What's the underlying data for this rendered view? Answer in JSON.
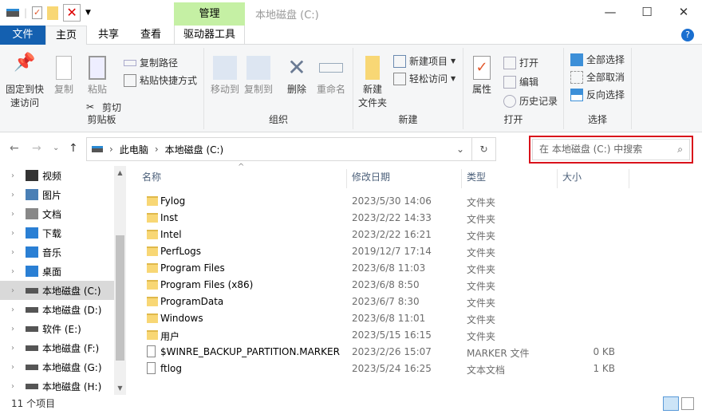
{
  "window": {
    "title": "本地磁盘 (C:)",
    "context_tab": "管理",
    "minimize": "—",
    "maximize": "☐",
    "close": "✕"
  },
  "tabs": {
    "file": "文件",
    "home": "主页",
    "share": "共享",
    "view": "查看",
    "drive_tools": "驱动器工具"
  },
  "ribbon": {
    "clipboard": {
      "label": "剪贴板",
      "pin": "固定到快速访问",
      "copy": "复制",
      "paste": "粘贴",
      "copy_path": "复制路径",
      "paste_shortcut": "粘贴快捷方式",
      "cut": "剪切"
    },
    "organize": {
      "label": "组织",
      "move_to": "移动到",
      "copy_to": "复制到",
      "delete": "删除",
      "rename": "重命名"
    },
    "new": {
      "label": "新建",
      "new_folder": "新建\n文件夹",
      "new_item": "新建项目",
      "easy_access": "轻松访问"
    },
    "open": {
      "label": "打开",
      "properties": "属性",
      "open": "打开",
      "edit": "编辑",
      "history": "历史记录"
    },
    "select": {
      "label": "选择",
      "select_all": "全部选择",
      "select_none": "全部取消",
      "invert": "反向选择"
    }
  },
  "address": {
    "crumbs": [
      "此电脑",
      "本地磁盘 (C:)"
    ],
    "search_placeholder": "在 本地磁盘 (C:) 中搜索"
  },
  "sidebar": [
    {
      "label": "视频",
      "icon": "video-icon"
    },
    {
      "label": "图片",
      "icon": "pictures-icon"
    },
    {
      "label": "文档",
      "icon": "documents-icon"
    },
    {
      "label": "下载",
      "icon": "download-icon"
    },
    {
      "label": "音乐",
      "icon": "music-icon"
    },
    {
      "label": "桌面",
      "icon": "desktop-icon"
    },
    {
      "label": "本地磁盘 (C:)",
      "icon": "drive-icon",
      "selected": true
    },
    {
      "label": "本地磁盘 (D:)",
      "icon": "drive-icon"
    },
    {
      "label": "软件 (E:)",
      "icon": "drive-icon"
    },
    {
      "label": "本地磁盘 (F:)",
      "icon": "drive-icon"
    },
    {
      "label": "本地磁盘 (G:)",
      "icon": "drive-icon"
    },
    {
      "label": "本地磁盘 (H:)",
      "icon": "drive-icon"
    }
  ],
  "columns": {
    "name": "名称",
    "date": "修改日期",
    "type": "类型",
    "size": "大小"
  },
  "files": [
    {
      "name": "Fylog",
      "date": "2023/5/30 14:06",
      "type": "文件夹",
      "size": "",
      "kind": "folder"
    },
    {
      "name": "Inst",
      "date": "2023/2/22 14:33",
      "type": "文件夹",
      "size": "",
      "kind": "folder"
    },
    {
      "name": "Intel",
      "date": "2023/2/22 16:21",
      "type": "文件夹",
      "size": "",
      "kind": "folder"
    },
    {
      "name": "PerfLogs",
      "date": "2019/12/7 17:14",
      "type": "文件夹",
      "size": "",
      "kind": "folder"
    },
    {
      "name": "Program Files",
      "date": "2023/6/8 11:03",
      "type": "文件夹",
      "size": "",
      "kind": "folder"
    },
    {
      "name": "Program Files (x86)",
      "date": "2023/6/8 8:50",
      "type": "文件夹",
      "size": "",
      "kind": "folder"
    },
    {
      "name": "ProgramData",
      "date": "2023/6/7 8:30",
      "type": "文件夹",
      "size": "",
      "kind": "folder"
    },
    {
      "name": "Windows",
      "date": "2023/6/8 11:01",
      "type": "文件夹",
      "size": "",
      "kind": "folder"
    },
    {
      "name": "用户",
      "date": "2023/5/15 16:15",
      "type": "文件夹",
      "size": "",
      "kind": "folder"
    },
    {
      "name": "$WINRE_BACKUP_PARTITION.MARKER",
      "date": "2023/2/26 15:07",
      "type": "MARKER 文件",
      "size": "0 KB",
      "kind": "file"
    },
    {
      "name": "ftlog",
      "date": "2023/5/24 16:25",
      "type": "文本文档",
      "size": "1 KB",
      "kind": "file"
    }
  ],
  "status": {
    "count": "11 个项目"
  }
}
